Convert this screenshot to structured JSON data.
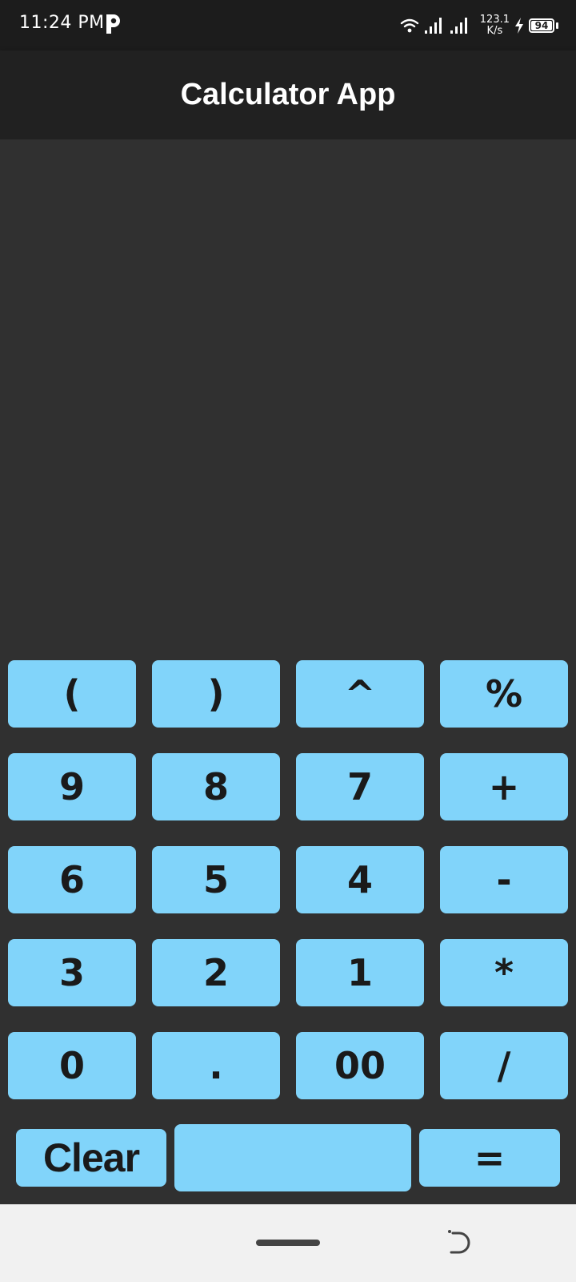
{
  "status_bar": {
    "time": "11:24 PM",
    "app_icon": "p-letter-icon",
    "net_speed_value": "123.1",
    "net_speed_unit": "K/s",
    "battery_level": "94"
  },
  "app_bar": {
    "title": "Calculator App"
  },
  "display": {
    "expression": ""
  },
  "keypad": {
    "keys": [
      "(",
      ")",
      "^",
      "%",
      "9",
      "8",
      "7",
      "+",
      "6",
      "5",
      "4",
      "-",
      "3",
      "2",
      "1",
      "*",
      "0",
      ".",
      "00",
      "/"
    ]
  },
  "actions": {
    "clear_label": "Clear",
    "result": "",
    "equals_label": "="
  },
  "colors": {
    "key_background": "#81d4fa",
    "app_bar_background": "#212121",
    "screen_background": "#303030",
    "status_bar_background": "#1c1c1c",
    "nav_bar_background": "#f1f1f1"
  },
  "nav_bar": {
    "home_icon": "home-pill-icon",
    "back_icon": "back-icon"
  }
}
